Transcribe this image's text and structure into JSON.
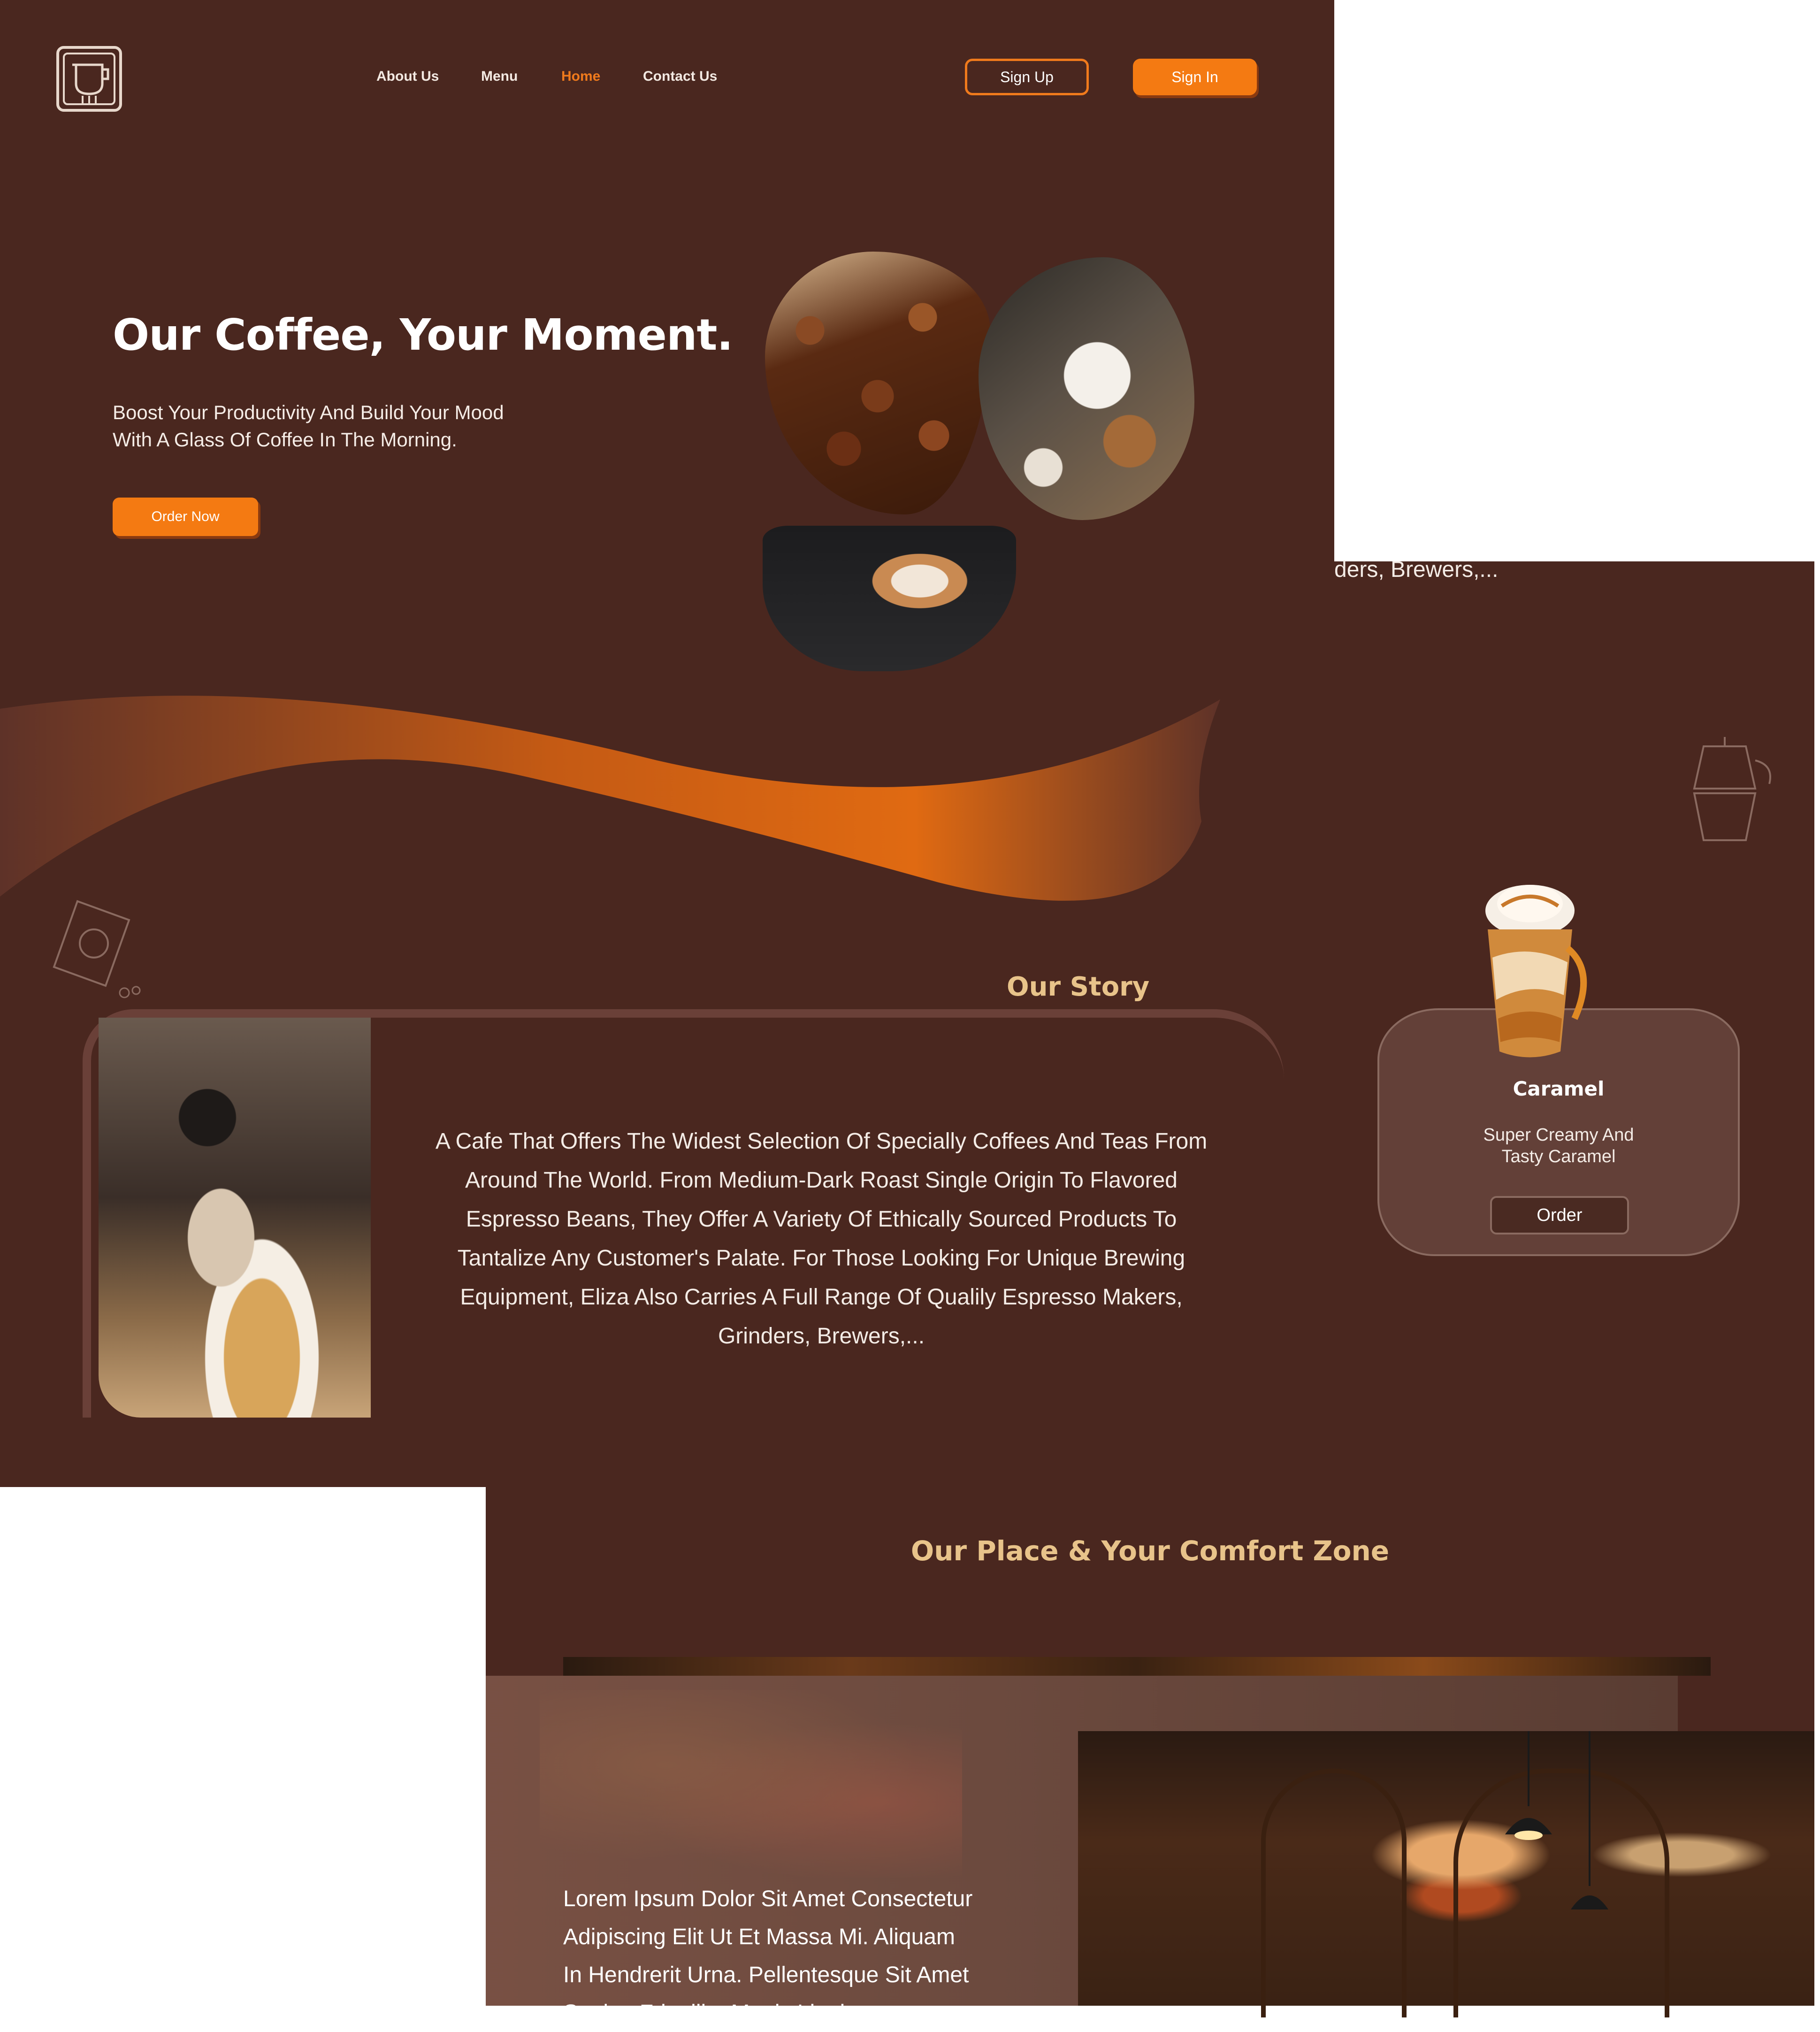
{
  "nav": {
    "logo_icon": "coffee-cup-logo",
    "links": [
      "About Us",
      "Menu",
      "Home",
      "Contact Us"
    ],
    "active_index": 2,
    "signup_label": "Sign Up",
    "signin_label": "Sign In"
  },
  "hero": {
    "title": "Our Coffee, Your Moment.",
    "subtitle_line1": "Boost Your Productivity And Build Your Mood",
    "subtitle_line2": "With A Glass Of Coffee In The Morning.",
    "cta_label": "Order Now"
  },
  "story": {
    "title": "Our Story",
    "text": "A Cafe That Offers The Widest Selection Of Specially Coffees And Teas From Around The World. From Medium-Dark Roast Single Origin To Flavored Espresso Beans, They Offer A Variety Of Ethically Sourced Products To Tantalize Any Customer's Palate. For Those Looking For Unique Brewing Equipment, Eliza Also Carries A Full Range Of Qualily Espresso Makers, Grinders, Brewers,..."
  },
  "side": {
    "truncated_text": "ders, Brewers,...",
    "product": {
      "name": "Caramel",
      "desc_line1": "Super Creamy And",
      "desc_line2": "Tasty Caramel",
      "order_label": "Order"
    }
  },
  "comfort": {
    "title": "Our Place & Your Comfort Zone",
    "text_lines": [
      "Lorem Ipsum Dolor Sit Amet Consectetur",
      "Adipiscing Elit Ut Et Massa Mi. Aliquam",
      "In Hendrerit Urna. Pellentesque Sit Amet",
      "Sapien Fringilla, Mattis Ligula..."
    ]
  },
  "colors": {
    "background": "#4a271f",
    "accent": "#f47a12",
    "heading_gold": "#e8c38a",
    "card": "#634038"
  }
}
